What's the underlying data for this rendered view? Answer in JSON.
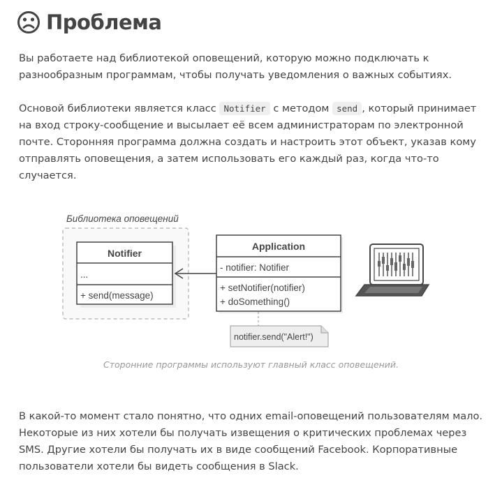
{
  "header": {
    "icon": "sad-face-icon",
    "title": "Проблема"
  },
  "paragraph1": "Вы работаете над библиотекой оповещений, которую можно подключать к разнообразным программам, чтобы получать уведомления о важных событиях.",
  "paragraph2": {
    "text_before_code1": "Основой библиотеки является класс ",
    "code1": "Notifier",
    "text_between": " с методом ",
    "code2": "send",
    "text_after": ", который принимает на вход строку-сообщение и высылает её всем администраторам по электронной почте. Сторонняя программа должна создать и настроить этот объект, указав кому отправлять оповещения, а затем использовать его каждый раз, когда что-то случается."
  },
  "diagram": {
    "group_label": "Библиотека оповещений",
    "notifier_class": {
      "name": "Notifier",
      "fields": "...",
      "methods": "+ send(message)"
    },
    "application_class": {
      "name": "Application",
      "fields": "- notifier: Notifier",
      "method1": "+ setNotifier(notifier)",
      "method2": "+ doSomething()"
    },
    "note": "notifier.send(\"Alert!\")",
    "laptop_icon": "laptop-icon"
  },
  "caption": "Сторонние программы используют главный класс оповещений.",
  "paragraph3": "В какой-то момент стало понятно, что одних email-оповещений пользователям мало. Некоторые из них хотели бы получать извещения о критических проблемах через SMS. Другие хотели бы получать их в виде сообщений Facebook. Корпоративные пользователи хотели бы видеть сообщения в Slack."
}
